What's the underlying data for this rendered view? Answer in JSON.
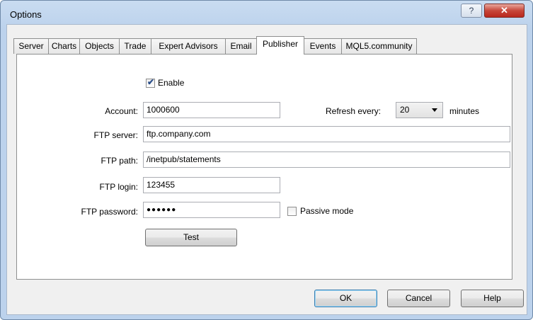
{
  "window": {
    "title": "Options",
    "help_button": "?",
    "close_button": "✕"
  },
  "tabs": [
    {
      "label": "Server"
    },
    {
      "label": "Charts"
    },
    {
      "label": "Objects"
    },
    {
      "label": "Trade"
    },
    {
      "label": "Expert Advisors"
    },
    {
      "label": "Email"
    },
    {
      "label": "Publisher",
      "active": true
    },
    {
      "label": "Events"
    },
    {
      "label": "MQL5.community"
    }
  ],
  "publisher": {
    "enable": {
      "label": "Enable",
      "checked": true
    },
    "account": {
      "label": "Account:",
      "value": "1000600"
    },
    "refresh": {
      "label": "Refresh every:",
      "value": "20",
      "unit": "minutes"
    },
    "ftp_server": {
      "label": "FTP server:",
      "value": "ftp.company.com"
    },
    "ftp_path": {
      "label": "FTP path:",
      "value": "/inetpub/statements"
    },
    "ftp_login": {
      "label": "FTP login:",
      "value": "123455"
    },
    "ftp_password": {
      "label": "FTP password:",
      "value": "●●●●●●"
    },
    "passive_mode": {
      "label": "Passive mode",
      "checked": false
    },
    "test_button": "Test"
  },
  "footer": {
    "ok": "OK",
    "cancel": "Cancel",
    "help": "Help"
  }
}
